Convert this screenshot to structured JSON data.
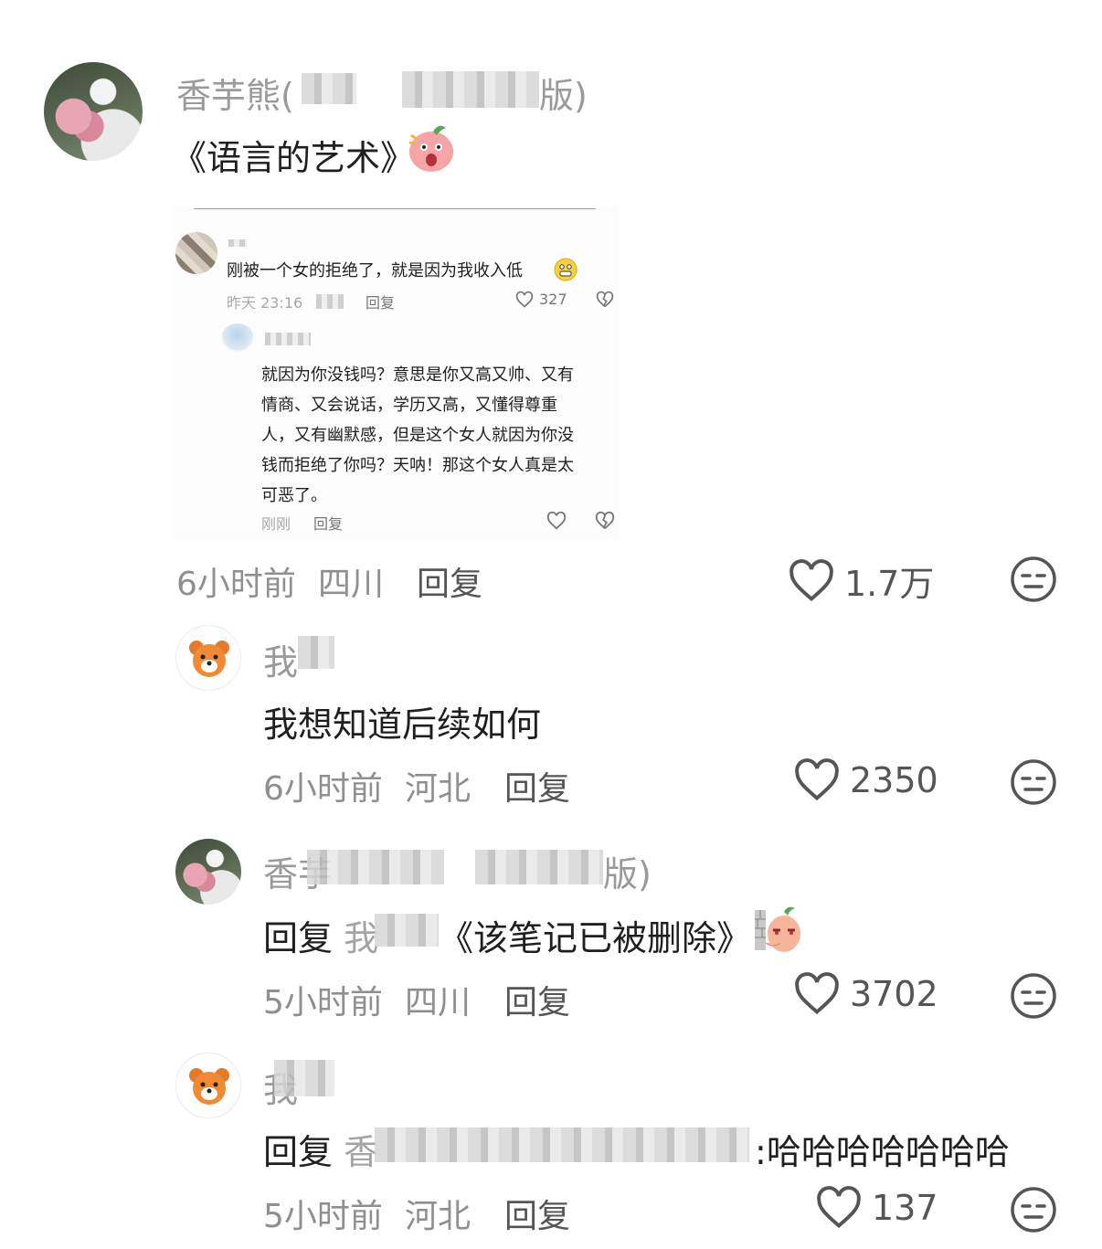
{
  "comments": [
    {
      "author": "香芋熊(",
      "author_tail": "版)",
      "content": "《语言的艺术》",
      "emoji": "shocked-face-sticker",
      "time": "6小时前",
      "location": "四川",
      "reply_label": "回复",
      "likes": "1.7万"
    },
    {
      "author": "我",
      "content": "我想知道后续如何",
      "time": "6小时前",
      "location": "河北",
      "reply_label": "回复",
      "likes": "2350"
    },
    {
      "author": "香芋",
      "author_tail": "版)",
      "reply_prefix": "回复",
      "reply_to": "我",
      "content": "《该笔记已被删除》",
      "emoji": "peeking-sticker",
      "time": "5小时前",
      "location": "四川",
      "reply_label": "回复",
      "likes": "3702"
    },
    {
      "author": "我",
      "reply_prefix": "回复",
      "reply_to": "香",
      "reply_to_tail": ":",
      "content": "哈哈哈哈哈哈哈",
      "time": "5小时前",
      "location": "河北",
      "reply_label": "回复",
      "likes": "137"
    }
  ],
  "screenshot": {
    "comment1": {
      "text": "刚被一个女的拒绝了，就是因为我收入低",
      "time": "昨天 23:16",
      "reply_label": "回复",
      "likes": "327"
    },
    "comment2": {
      "lines": [
        "就因为你没钱吗？意思是你又高又帅、又有",
        "情商、又会说话，学历又高，又懂得尊重",
        "人，又有幽默感，但是这个女人就因为你没",
        "钱而拒绝了你吗？天呐！那这个女人真是太",
        "可恶了。"
      ],
      "time": "刚刚",
      "reply_label": "回复"
    }
  }
}
